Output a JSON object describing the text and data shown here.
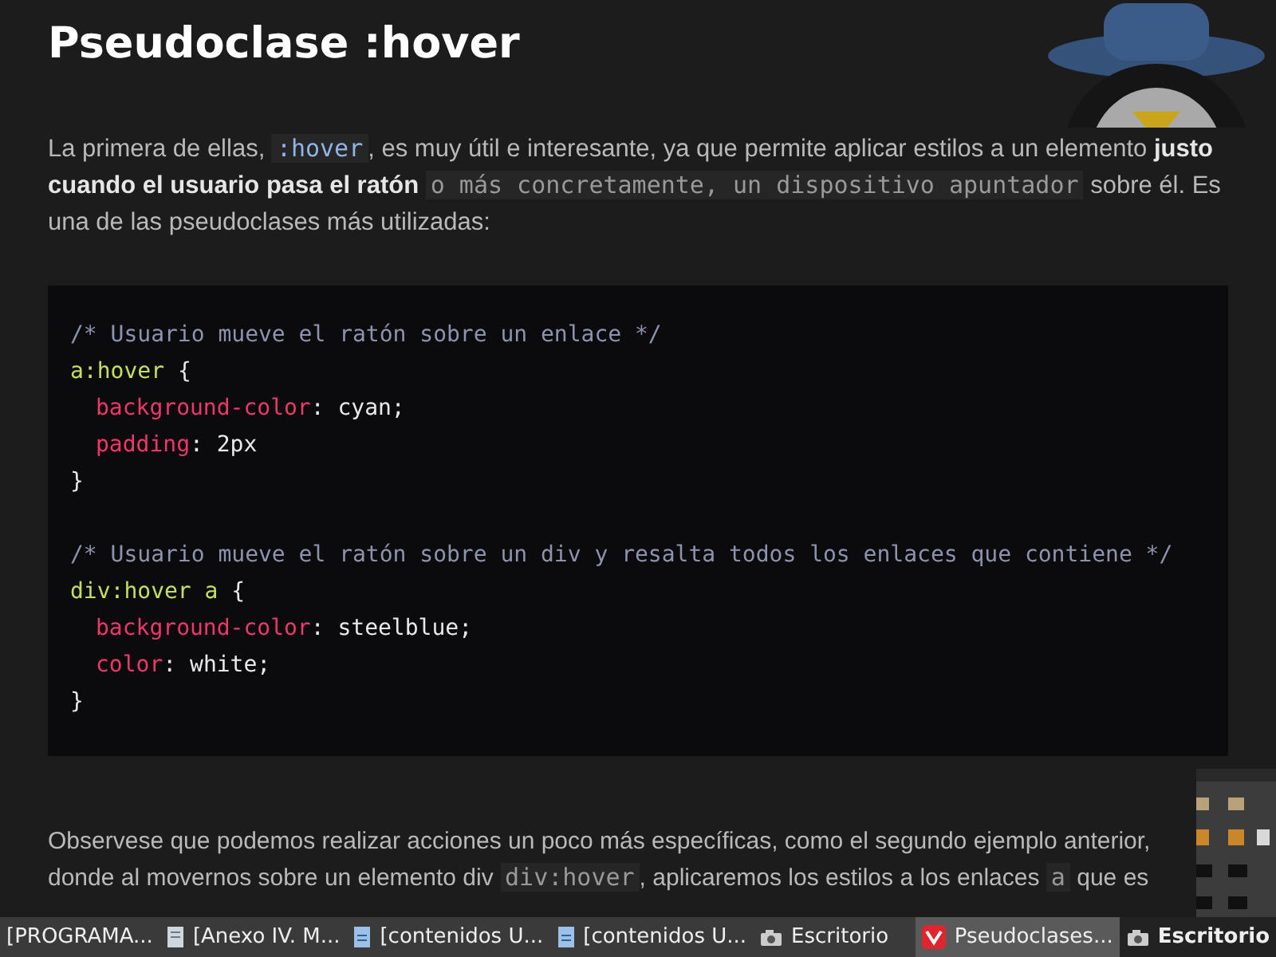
{
  "title": "Pseudoclase :hover",
  "intro": [
    {
      "kind": "text",
      "text": "La primera de ellas, "
    },
    {
      "kind": "code",
      "text": ":hover"
    },
    {
      "kind": "text",
      "text": ", es muy útil e interesante, ya que permite aplicar estilos a un elemento **justo cuando el usuario pasa el ratón** "
    },
    {
      "kind": "code",
      "text": "o más concretamente, un dispositivo apuntador"
    },
    {
      "kind": "text",
      "text": " sobre él. Es una de las pseudoclases más utilizadas:"
    }
  ],
  "code_groups": [
    [
      {
        "indent": false,
        "tokens": [
          {
            "kind": "comment",
            "text": "/* Usuario mueve el ratón sobre un enlace */"
          }
        ]
      },
      {
        "indent": false,
        "tokens": [
          {
            "kind": "selector",
            "text": "a:hover"
          },
          {
            "kind": "plain",
            "text": " {"
          }
        ]
      },
      {
        "indent": true,
        "tokens": [
          {
            "kind": "property",
            "text": "background-color"
          },
          {
            "kind": "plain",
            "text": ": cyan;"
          }
        ]
      },
      {
        "indent": true,
        "tokens": [
          {
            "kind": "property",
            "text": "padding"
          },
          {
            "kind": "plain",
            "text": ": 2px"
          }
        ]
      },
      {
        "indent": false,
        "tokens": [
          {
            "kind": "plain",
            "text": "}"
          }
        ]
      }
    ],
    [
      {
        "indent": false,
        "tokens": [
          {
            "kind": "comment",
            "text": "/* Usuario mueve el ratón sobre un div y resalta todos los enlaces que contiene */"
          }
        ]
      },
      {
        "indent": false,
        "tokens": [
          {
            "kind": "selector",
            "text": "div:hover a"
          },
          {
            "kind": "plain",
            "text": " {"
          }
        ]
      },
      {
        "indent": true,
        "tokens": [
          {
            "kind": "property",
            "text": "background-color"
          },
          {
            "kind": "plain",
            "text": ": steelblue;"
          }
        ]
      },
      {
        "indent": true,
        "tokens": [
          {
            "kind": "property",
            "text": "color"
          },
          {
            "kind": "plain",
            "text": ": white;"
          }
        ]
      },
      {
        "indent": false,
        "tokens": [
          {
            "kind": "plain",
            "text": "}"
          }
        ]
      }
    ]
  ],
  "outro": [
    {
      "kind": "text",
      "text": "Observese que podemos realizar acciones un poco más específicas, como el segundo ejemplo anterior, donde al movernos sobre un elemento div "
    },
    {
      "kind": "code",
      "text": "div:hover"
    },
    {
      "kind": "text",
      "text": ", aplicaremos los estilos a los enlaces "
    },
    {
      "kind": "code",
      "text": "a"
    },
    {
      "kind": "text",
      "text": " que es"
    }
  ],
  "taskbar": [
    {
      "label": "[PROGRAMA...",
      "kind": "plain",
      "selected": false
    },
    {
      "label": "[Anexo IV. M...",
      "kind": "document",
      "selected": false
    },
    {
      "label": "[contenidos U...",
      "kind": "text",
      "selected": false
    },
    {
      "label": "[contenidos U...",
      "kind": "text",
      "selected": false
    },
    {
      "label": "Escritorio",
      "kind": "folder",
      "selected": false
    },
    {
      "label": "Pseudoclases...",
      "kind": "browser",
      "selected": true
    },
    {
      "label": "Escritorio",
      "kind": "desktop",
      "selected": false
    }
  ]
}
